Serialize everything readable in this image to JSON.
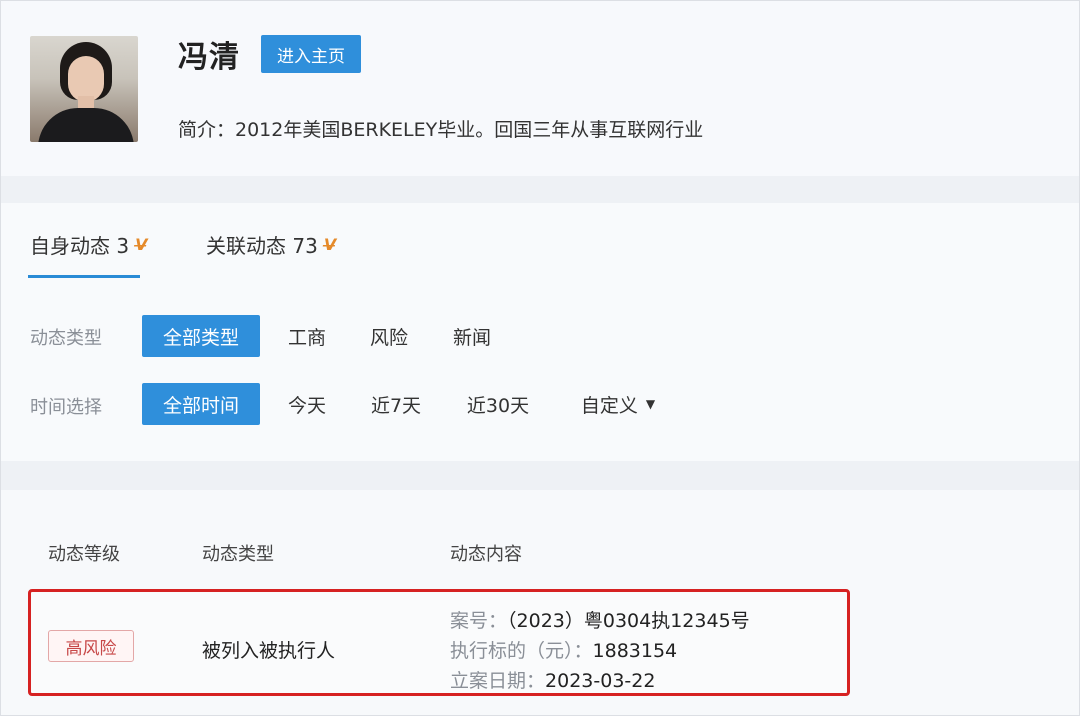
{
  "profile": {
    "name": "冯清",
    "home_button": "进入主页",
    "intro": "简介：2012年美国BERKELEY毕业。回国三年从事互联网行业"
  },
  "tabs": [
    {
      "label": "自身动态 3",
      "icon": "v-badge-icon",
      "active": true
    },
    {
      "label": "关联动态 73",
      "icon": "v-badge-icon",
      "active": false
    }
  ],
  "filters": {
    "type": {
      "label": "动态类型",
      "options": [
        "全部类型",
        "工商",
        "风险",
        "新闻"
      ],
      "selected": "全部类型"
    },
    "time": {
      "label": "时间选择",
      "options": [
        "全部时间",
        "今天",
        "近7天",
        "近30天",
        "自定义"
      ],
      "selected": "全部时间"
    }
  },
  "table": {
    "headers": [
      "动态等级",
      "动态类型",
      "动态内容"
    ],
    "rows": [
      {
        "level": "高风险",
        "type": "被列入被执行人",
        "details": [
          {
            "key": "案号：",
            "value": "（2023）粤0304执12345号"
          },
          {
            "key": "执行标的（元）：",
            "value": "1883154"
          },
          {
            "key": "立案日期：",
            "value": "2023-03-22"
          }
        ]
      }
    ]
  },
  "colors": {
    "accent": "#2f8fdb",
    "highlight_border": "#d62222",
    "risk_text": "#c74848",
    "v_badge": "#e58a2a"
  }
}
